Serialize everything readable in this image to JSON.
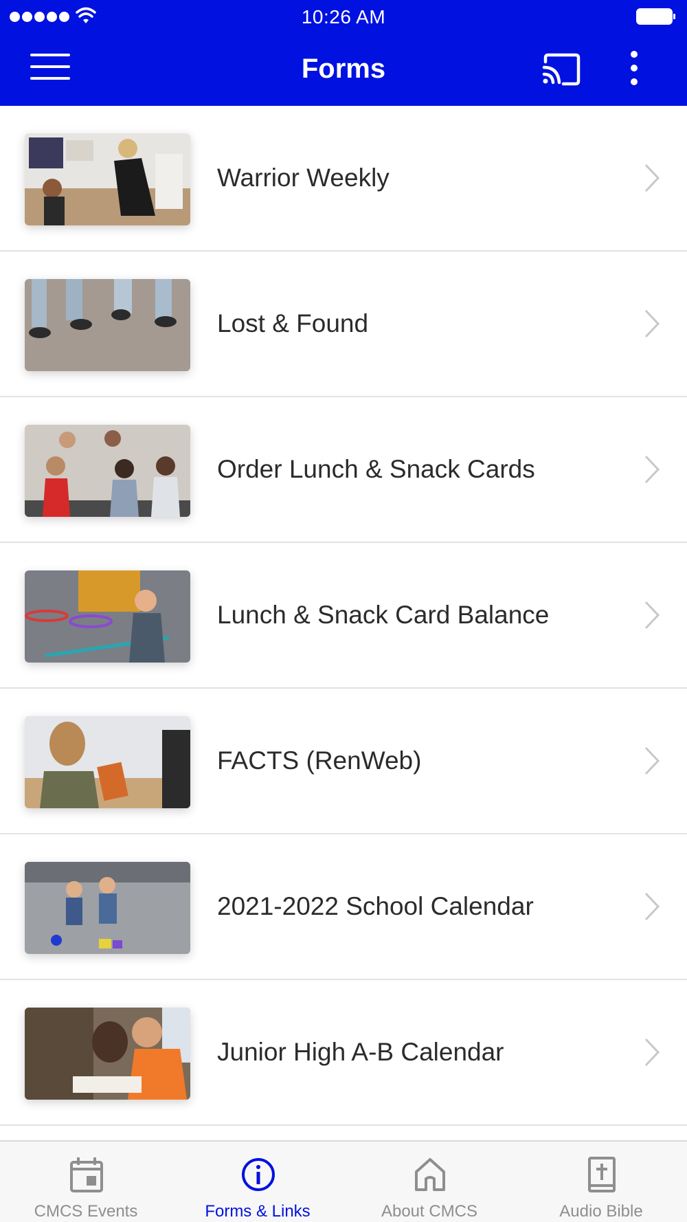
{
  "status_bar": {
    "time": "10:26 AM"
  },
  "app_bar": {
    "title": "Forms"
  },
  "colors": {
    "brand": "#0011e0",
    "inactive_tab": "#8e8e8e",
    "divider": "#e3e3e3"
  },
  "forms": [
    {
      "label": "Warrior Weekly"
    },
    {
      "label": "Lost & Found"
    },
    {
      "label": "Order Lunch & Snack Cards"
    },
    {
      "label": "Lunch & Snack Card Balance"
    },
    {
      "label": "FACTS (RenWeb)"
    },
    {
      "label": "2021-2022 School Calendar"
    },
    {
      "label": "Junior High A-B Calendar"
    }
  ],
  "tabs": [
    {
      "label": "CMCS Events",
      "icon": "calendar-icon",
      "active": false
    },
    {
      "label": "Forms & Links",
      "icon": "info-icon",
      "active": true
    },
    {
      "label": "About CMCS",
      "icon": "home-icon",
      "active": false
    },
    {
      "label": "Audio Bible",
      "icon": "bible-icon",
      "active": false
    }
  ]
}
